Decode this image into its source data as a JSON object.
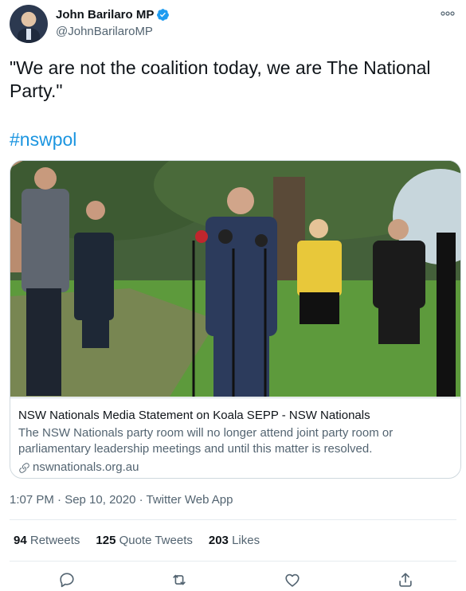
{
  "author": {
    "name": "John Barilaro MP",
    "handle": "@JohnBarilaroMP",
    "verified_icon": "verified-badge-icon"
  },
  "tweet": {
    "text": "\"We are not the coalition today, we are The National Party.\"",
    "hashtag": "#nswpol"
  },
  "card": {
    "title": "NSW Nationals Media Statement on Koala SEPP - NSW Nationals",
    "description": "The NSW Nationals party room will no longer attend joint party room or parliamentary leadership meetings and until this matter is resolved.",
    "domain": "nswnationals.org.au"
  },
  "meta": {
    "timestamp": "1:07 PM · Sep 10, 2020 · Twitter Web App"
  },
  "stats": {
    "retweets_count": "94",
    "retweets_label": "Retweets",
    "quotes_count": "125",
    "quotes_label": "Quote Tweets",
    "likes_count": "203",
    "likes_label": "Likes"
  },
  "colors": {
    "accent": "#1b95e0",
    "secondary_text": "#536471",
    "border": "#cfd9de"
  }
}
